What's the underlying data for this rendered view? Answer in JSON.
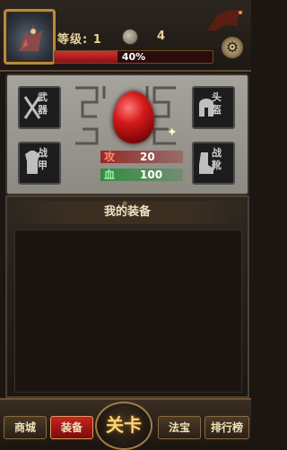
{
  "header": {
    "level_label": "等级: 1",
    "coin_count": "4",
    "exp_text": "40%",
    "exp_fraction": 0.4
  },
  "equipment": {
    "weapon_label": "武器",
    "helmet_label": "头盔",
    "armor_label": "战甲",
    "boots_label": "战靴"
  },
  "stats": {
    "attack_label": "攻",
    "attack_value": "20",
    "hp_label": "血",
    "hp_value": "100"
  },
  "inventory": {
    "title": "我的装备"
  },
  "nav": {
    "shop_label": "商城",
    "equip_label": "装备",
    "stage_label": "关卡",
    "treasure_label": "法宝",
    "rank_label": "排行榜"
  },
  "colors": {
    "exp_red": "#d23030",
    "active_tab": "#c62424",
    "gold_text": "#e9d29a"
  }
}
